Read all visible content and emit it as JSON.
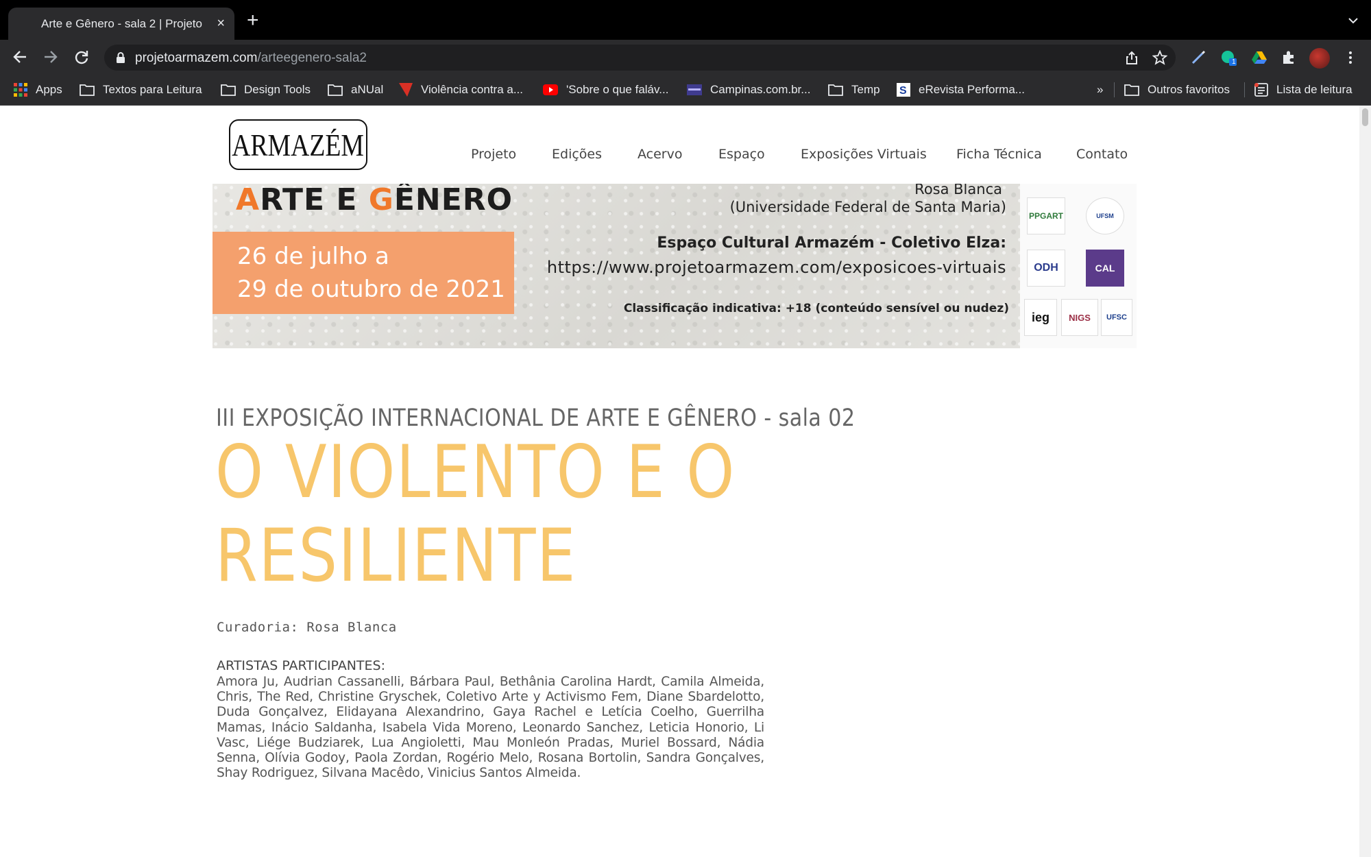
{
  "browser": {
    "tab_title": "Arte e Gênero - sala 2 | Projeto",
    "tab_close": "×",
    "new_tab": "+",
    "url_domain": "projetoarmazem.com",
    "url_path": "/arteegenero-sala2",
    "profile_badge": "1"
  },
  "bookmarks": {
    "items": [
      "Apps",
      "Textos para Leitura",
      "Design Tools",
      "aNUal",
      "Violência contra a...",
      "'Sobre o que faláv...",
      "Campinas.com.br...",
      "Temp",
      "eRevista Performa..."
    ],
    "overflow": "»",
    "other": "Outros favoritos",
    "reading_list": "Lista de leitura"
  },
  "site": {
    "logo": "ARMAZÉM",
    "nav": [
      "Projeto",
      "Edições",
      "Acervo",
      "Espaço",
      "Exposições Virtuais",
      "Ficha Técnica",
      "Contato"
    ]
  },
  "banner": {
    "title_a": "A",
    "title_mid": "RTE E ",
    "title_g": "G",
    "title_end": "ÊNERO",
    "date_line1": "26 de julho a",
    "date_line2": "29 de outubro de 2021",
    "curator": "Rosa Blanca",
    "university": "(Universidade Federal de Santa Maria)",
    "venue": "Espaço Cultural Armazém - Coletivo Elza:",
    "link": "https://www.projetoarmazem.com/exposicoes-virtuais",
    "rating": "Classificação indicativa: +18 (conteúdo sensível ou nudez)",
    "partner_logos": [
      "PPGART",
      "UFSM",
      "ODH",
      "CAL",
      "ieg",
      "NIGS",
      "UFSC"
    ]
  },
  "content": {
    "kicker": "III EXPOSIÇÃO INTERNACIONAL DE ARTE E GÊNERO - sala 02",
    "headline_line1": "O VIOLENTO E O",
    "headline_line2": "RESILIENTE",
    "curadoria": "Curadoria: Rosa Blanca",
    "artists_heading": "ARTISTAS PARTICIPANTES:",
    "artists": "Amora Ju, Audrian Cassanelli, Bárbara Paul, Bethânia Carolina Hardt, Camila Almeida, Chris, The Red, Christine Gryschek, Coletivo Arte y Activismo Fem, Diane Sbardelotto, Duda Gonçalvez, Elidayana Alexandrino, Gaya Rachel e Letícia Coelho, Guerrilha Mamas, Inácio Saldanha, Isabela Vida Moreno, Leonardo Sanchez, Leticia Honorio, Li Vasc, Liége Budziarek, Lua Angioletti, Mau Monleón Pradas, Muriel Bossard, Nádia Senna, Olívia Godoy, Paola Zordan, Rogério Melo, Rosana Bortolin, Sandra Gonçalves, Shay Rodriguez, Silvana Macêdo, Vinicius Santos Almeida."
  },
  "colors": {
    "chrome_dark": "#2b2b2d",
    "headline": "#f7c66b",
    "date_box": "#f4a06d",
    "banner_orange": "#f0782a"
  }
}
